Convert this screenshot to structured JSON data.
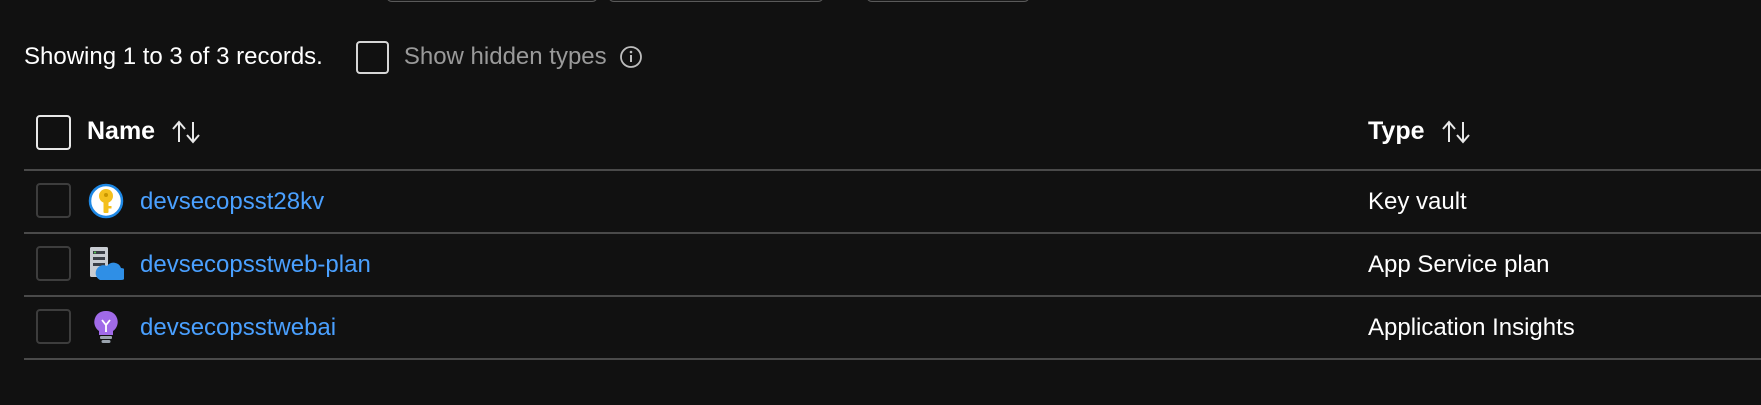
{
  "summary": {
    "records_text": "Showing 1 to 3 of 3 records.",
    "show_hidden_label": "Show hidden types",
    "show_hidden_checked": false
  },
  "table": {
    "columns": [
      {
        "label": "Name",
        "sortable": true
      },
      {
        "label": "Type",
        "sortable": true
      }
    ],
    "rows": [
      {
        "name": "devsecopsst28kv",
        "type": "Key vault",
        "icon": "key-vault-icon"
      },
      {
        "name": "devsecopsstweb-plan",
        "type": "App Service plan",
        "icon": "app-service-plan-icon"
      },
      {
        "name": "devsecopsstwebai",
        "type": "Application Insights",
        "icon": "application-insights-icon"
      }
    ]
  },
  "colors": {
    "background": "#111111",
    "link": "#4aa0ff",
    "divider": "#4a4a4a",
    "muted_text": "#9a9a9a"
  }
}
